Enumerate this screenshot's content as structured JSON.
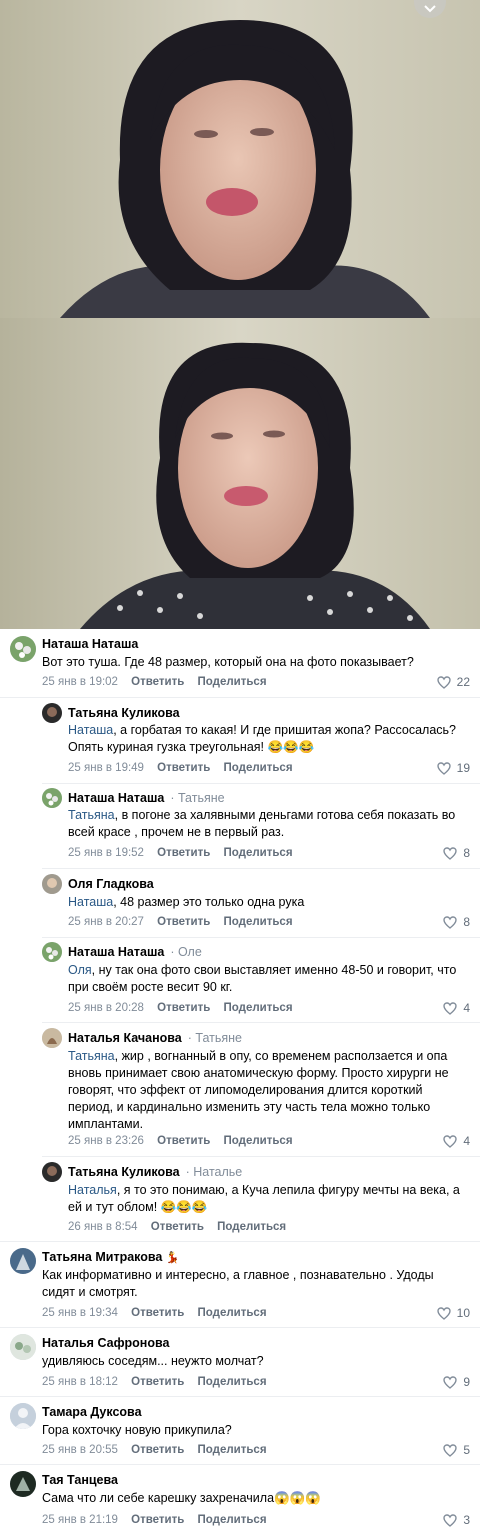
{
  "photos": [
    {
      "alt": "video-frame-1"
    },
    {
      "alt": "video-frame-2"
    }
  ],
  "actions": {
    "reply": "Ответить",
    "share": "Поделиться"
  },
  "comments": [
    {
      "author": "Наташа Наташа",
      "reply_to": "",
      "mention": "",
      "text": "Вот это туша. Где 48 размер, который она на фото показывает?",
      "date": "25 янв в 19:02",
      "likes": "22"
    },
    {
      "author": "Татьяна Куликова",
      "reply_to": "",
      "mention": "Наташа",
      "text": ", а горбатая то какая! И где пришитая жопа? Рассосалась? Опять куриная гузка треугольная! 😂😂😂",
      "date": "25 янв в 19:49",
      "likes": "19"
    },
    {
      "author": "Наташа Наташа",
      "reply_to": "Татьяне",
      "mention": "Татьяна",
      "text": ", в погоне за халявными деньгами готова себя показать во всей красе , прочем не в первый раз.",
      "date": "25 янв в 19:52",
      "likes": "8"
    },
    {
      "author": "Оля Гладкова",
      "reply_to": "",
      "mention": "Наташа",
      "text": ", 48 размер это только одна рука",
      "date": "25 янв в 20:27",
      "likes": "8"
    },
    {
      "author": "Наташа Наташа",
      "reply_to": "Оле",
      "mention": "Оля",
      "text": ", ну так она фото свои выставляет именно 48-50 и говорит, что при своём росте весит 90 кг.",
      "date": "25 янв в 20:28",
      "likes": "4"
    },
    {
      "author": "Наталья Качанова",
      "reply_to": "Татьяне",
      "mention": "Татьяна",
      "text": ", жир , вогнанный в опу, со временем расползается и опа вновь принимает свою анатомическую форму. Просто хирурги не говорят, что эффект от липомоделирования длится короткий период, и кардинально изменить эту часть тела можно только имплантами.",
      "date": "25 янв в 23:26",
      "likes": "4"
    },
    {
      "author": "Татьяна Куликова",
      "reply_to": "Наталье",
      "mention": "Наталья",
      "text": ", я то это понимаю, а Куча лепила фигуру мечты на века, а ей и тут облом! 😂😂😂",
      "date": "26 янв в 8:54",
      "likes": ""
    },
    {
      "author": "Татьяна Митракова",
      "reply_to": "",
      "mention": "",
      "text": "Как информативно и интересно, а главное , познавательно . Удоды сидят и смотрят.",
      "date": "25 янв в 19:34",
      "likes": "10",
      "badge": "💃"
    },
    {
      "author": "Наталья Сафронова",
      "reply_to": "",
      "mention": "",
      "text": "удивляюсь соседям... неужто молчат?",
      "date": "25 янв в 18:12",
      "likes": "9"
    },
    {
      "author": "Тамара Дуксова",
      "reply_to": "",
      "mention": "",
      "text": "Гора кохточку новую прикупила?",
      "date": "25 янв в 20:55",
      "likes": "5"
    },
    {
      "author": "Тая Танцева",
      "reply_to": "",
      "mention": "",
      "text": "Сама что ли себе карешку захреначила😱😱😱",
      "date": "25 янв в 21:19",
      "likes": "3"
    }
  ]
}
